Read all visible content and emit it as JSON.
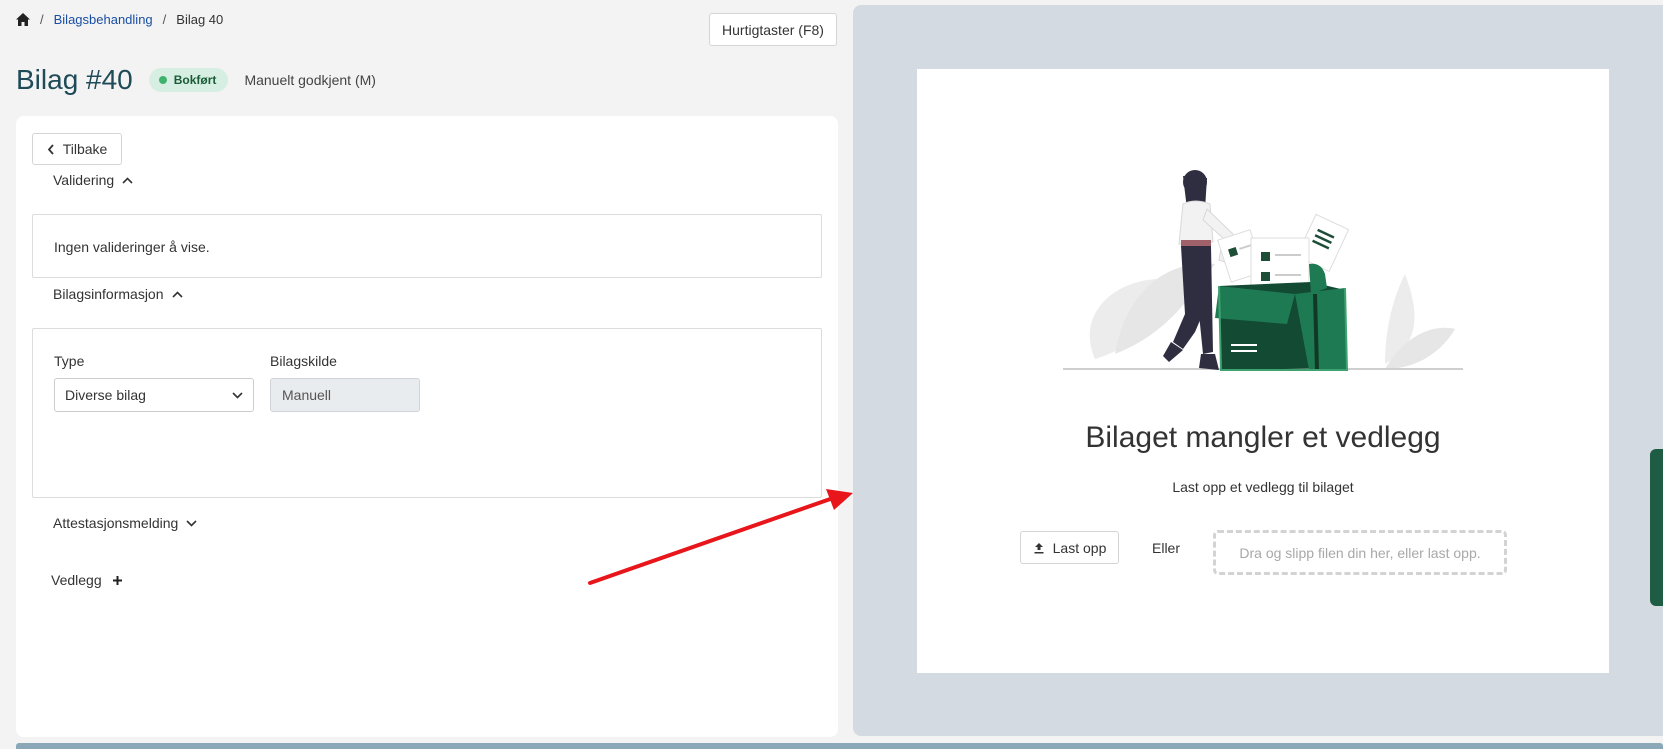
{
  "breadcrumb": {
    "home_icon": "home-icon",
    "items": [
      "Bilagsbehandling",
      "Bilag 40"
    ],
    "separator": "/"
  },
  "header": {
    "shortcut_button": "Hurtigtaster (F8)",
    "title": "Bilag #40",
    "status": "Bokført",
    "approval": "Manuelt godkjent (M)"
  },
  "left": {
    "back_button": "Tilbake",
    "validation": {
      "title": "Validering",
      "message": "Ingen valideringer å vise."
    },
    "info": {
      "title": "Bilagsinformasjon",
      "type_label": "Type",
      "type_value": "Diverse bilag",
      "source_label": "Bilagskilde",
      "source_value": "Manuell"
    },
    "attestation": {
      "title": "Attestasjonsmelding"
    },
    "attachments": {
      "title": "Vedlegg"
    }
  },
  "right": {
    "empty_title": "Bilaget mangler et vedlegg",
    "empty_subtitle": "Last opp et vedlegg til bilaget",
    "upload_button": "Last opp",
    "or_text": "Eller",
    "dropzone_placeholder": "Dra og slipp filen din her, eller last opp."
  },
  "colors": {
    "accent_green": "#1e7a52",
    "dark_green": "#134a33",
    "title_color": "#1f4a58",
    "annotation_arrow": "#e8161b"
  }
}
